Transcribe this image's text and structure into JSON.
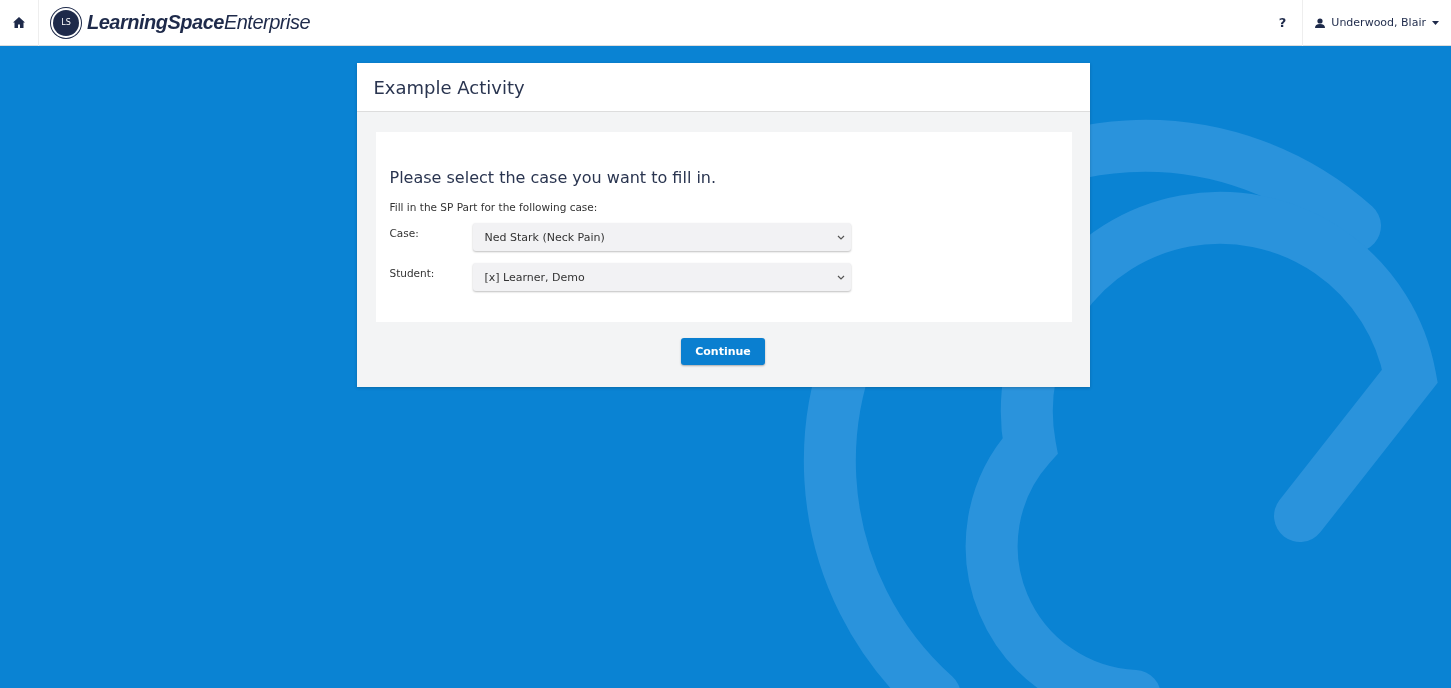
{
  "header": {
    "logo_badge": "LS",
    "logo_text": "**LearningSpace**Enterprise",
    "help": "?",
    "user": "Underwood, Blair"
  },
  "card": {
    "title": "Example Activity",
    "heading": "Please select the case you want to fill in.",
    "instruction": "Fill in the SP Part for the following case:",
    "fields": [
      {
        "label": "Case:",
        "value": "Ned Stark (Neck Pain)"
      },
      {
        "label": "Student:",
        "value": "[x] Learner, Demo"
      }
    ],
    "button": "Continue"
  }
}
